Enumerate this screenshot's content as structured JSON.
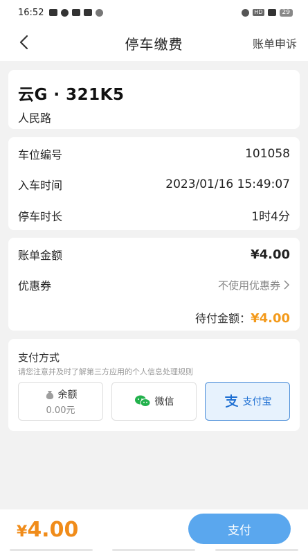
{
  "status_bar": {
    "time": "16:52",
    "battery": "29",
    "hd_tag": "HD"
  },
  "nav": {
    "title": "停车缴费",
    "appeal_label": "账单申诉"
  },
  "vehicle": {
    "plate": "云G · 321K5",
    "road": "人民路"
  },
  "parking_info": {
    "rows": [
      {
        "label": "车位编号",
        "value": "101058"
      },
      {
        "label": "入车时间",
        "value": "2023/01/16 15:49:07"
      },
      {
        "label": "停车时长",
        "value": "1时4分"
      }
    ]
  },
  "bill": {
    "amount_label": "账单金额",
    "amount_value": "¥4.00",
    "coupon_label": "优惠券",
    "coupon_value": "不使用优惠券",
    "pending_label": "待付金额：",
    "pending_value": "¥4.00"
  },
  "payment": {
    "title": "支付方式",
    "note": "请您注意并及时了解第三方应用的个人信息处理规则",
    "balance_label": "余额",
    "balance_value": "0.00元",
    "wechat_label": "微信",
    "alipay_label": "支付宝"
  },
  "footer": {
    "total_yen": "¥",
    "total_amount": "4.00",
    "pay_button": "支付"
  },
  "colors": {
    "accent_orange": "#f39a1b",
    "pay_button": "#5aa7ee",
    "alipay_blue": "#1c6ed2",
    "wechat_green": "#22b14c"
  }
}
